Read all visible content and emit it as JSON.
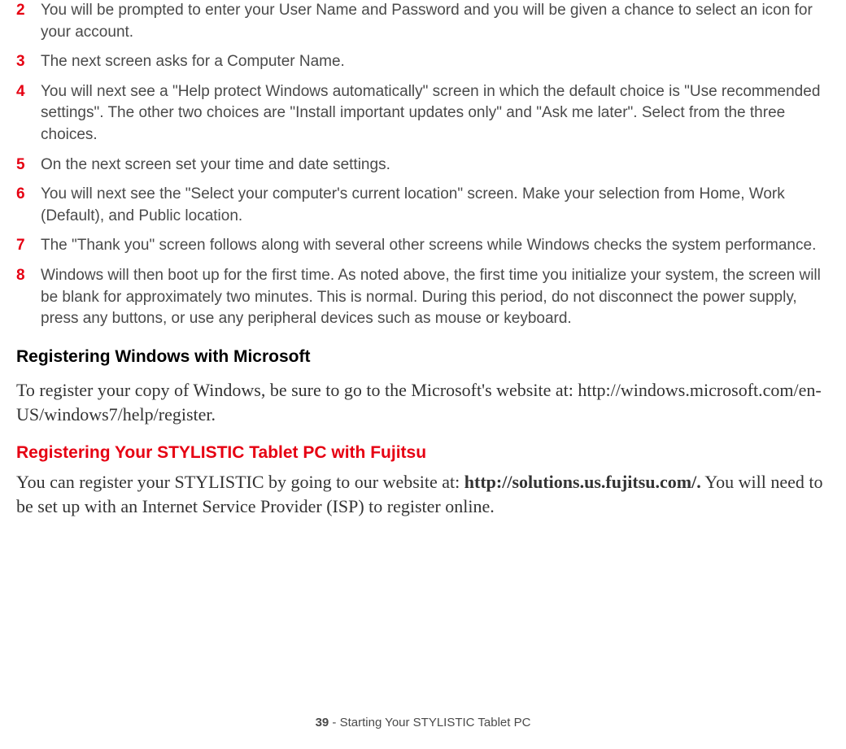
{
  "steps": [
    {
      "n": "2",
      "t": "You will be prompted to enter your User Name and Password and you will be given a chance to select an icon for your account."
    },
    {
      "n": "3",
      "t": "The next screen asks for a Computer Name."
    },
    {
      "n": "4",
      "t": "You will next see a \"Help protect Windows automatically\" screen in which the default choice is \"Use recommended settings\". The other two choices are \"Install important updates only\" and \"Ask me later\". Select from the three choices."
    },
    {
      "n": "5",
      "t": "On the next screen set your time and date settings."
    },
    {
      "n": "6",
      "t": "You will next see the \"Select your computer's current location\" screen. Make your selection from Home, Work (Default), and Public location."
    },
    {
      "n": "7",
      "t": "The \"Thank you\" screen follows along with several other screens while Windows checks the system performance."
    },
    {
      "n": "8",
      "t": "Windows will then boot up for the first time. As noted above, the first time you initialize your system, the screen will be blank for approximately two minutes. This is normal. During this period, do not disconnect the power supply, press any buttons, or use any peripheral devices such as mouse or keyboard."
    }
  ],
  "section1": {
    "heading": "Registering Windows with Microsoft",
    "body": "To register your copy of Windows, be sure to go to the Microsoft's website at: http://windows.microsoft.com/en-US/windows7/help/register."
  },
  "section2": {
    "heading": "Registering Your STYLISTIC Tablet PC with Fujitsu",
    "body_pre": "You can register your STYLISTIC by going to our website at: ",
    "body_bold": "http://solutions.us.fujitsu.com/.",
    "body_post": " You will need to be set up with an Internet Service Provider (ISP) to register online."
  },
  "footer": {
    "page": "39",
    "sep": " - ",
    "title": "Starting Your STYLISTIC Tablet PC"
  }
}
